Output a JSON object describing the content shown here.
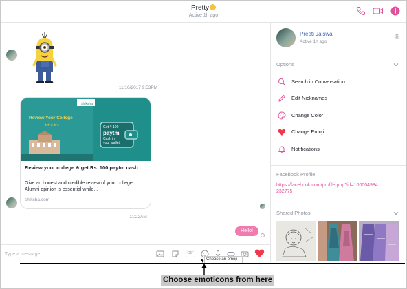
{
  "header": {
    "title": "Pretty",
    "status": "Active 1h ago",
    "icons": [
      "phone-icon",
      "video-call-icon",
      "info-icon"
    ],
    "accent_color": "#e0539a"
  },
  "conversation": {
    "timestamp_1": "11/16/2017 9:53PM",
    "timestamp_2": "11:22AM",
    "link_card": {
      "image_logo": "shiksha",
      "image_heading": "Review Your College",
      "image_offer_line1": "Get ₹ 100",
      "image_offer_brand": "paytm",
      "image_offer_line2": "Cash in",
      "image_offer_line3": "your wallet",
      "title": "Review your college & get Rs. 100 paytm cash",
      "description": "Give an honest and credible review of your college. Alumni opinion is essential while...",
      "domain": "shiksha.com"
    },
    "sent_message": "Hello!",
    "bubble_color": "#f07cae"
  },
  "composer": {
    "placeholder": "Type a message...",
    "gif_label": "GIF",
    "tooltip": "Choose an emoji",
    "icons": [
      "image-icon",
      "sticker-icon",
      "gif-icon",
      "emoji-icon",
      "mic-icon",
      "game-icon",
      "camera-icon",
      "like-heart-icon"
    ]
  },
  "annotation": {
    "caption": "Choose emoticons from here"
  },
  "right_panel": {
    "profile_name": "Preeti Jaiswal",
    "profile_status": "Active 1h ago",
    "options_header": "Options",
    "options": [
      {
        "label": "Search in Conversation",
        "icon": "search-icon"
      },
      {
        "label": "Edit Nicknames",
        "icon": "pencil-icon"
      },
      {
        "label": "Change Color",
        "icon": "palette-icon"
      },
      {
        "label": "Change Emoji",
        "icon": "heart-icon"
      },
      {
        "label": "Notifications",
        "icon": "bell-icon"
      }
    ],
    "facebook_profile_header": "Facebook Profile",
    "facebook_profile_link": "https://facebook.com/profile.php?id=100004984232775",
    "shared_photos_header": "Shared Photos"
  }
}
